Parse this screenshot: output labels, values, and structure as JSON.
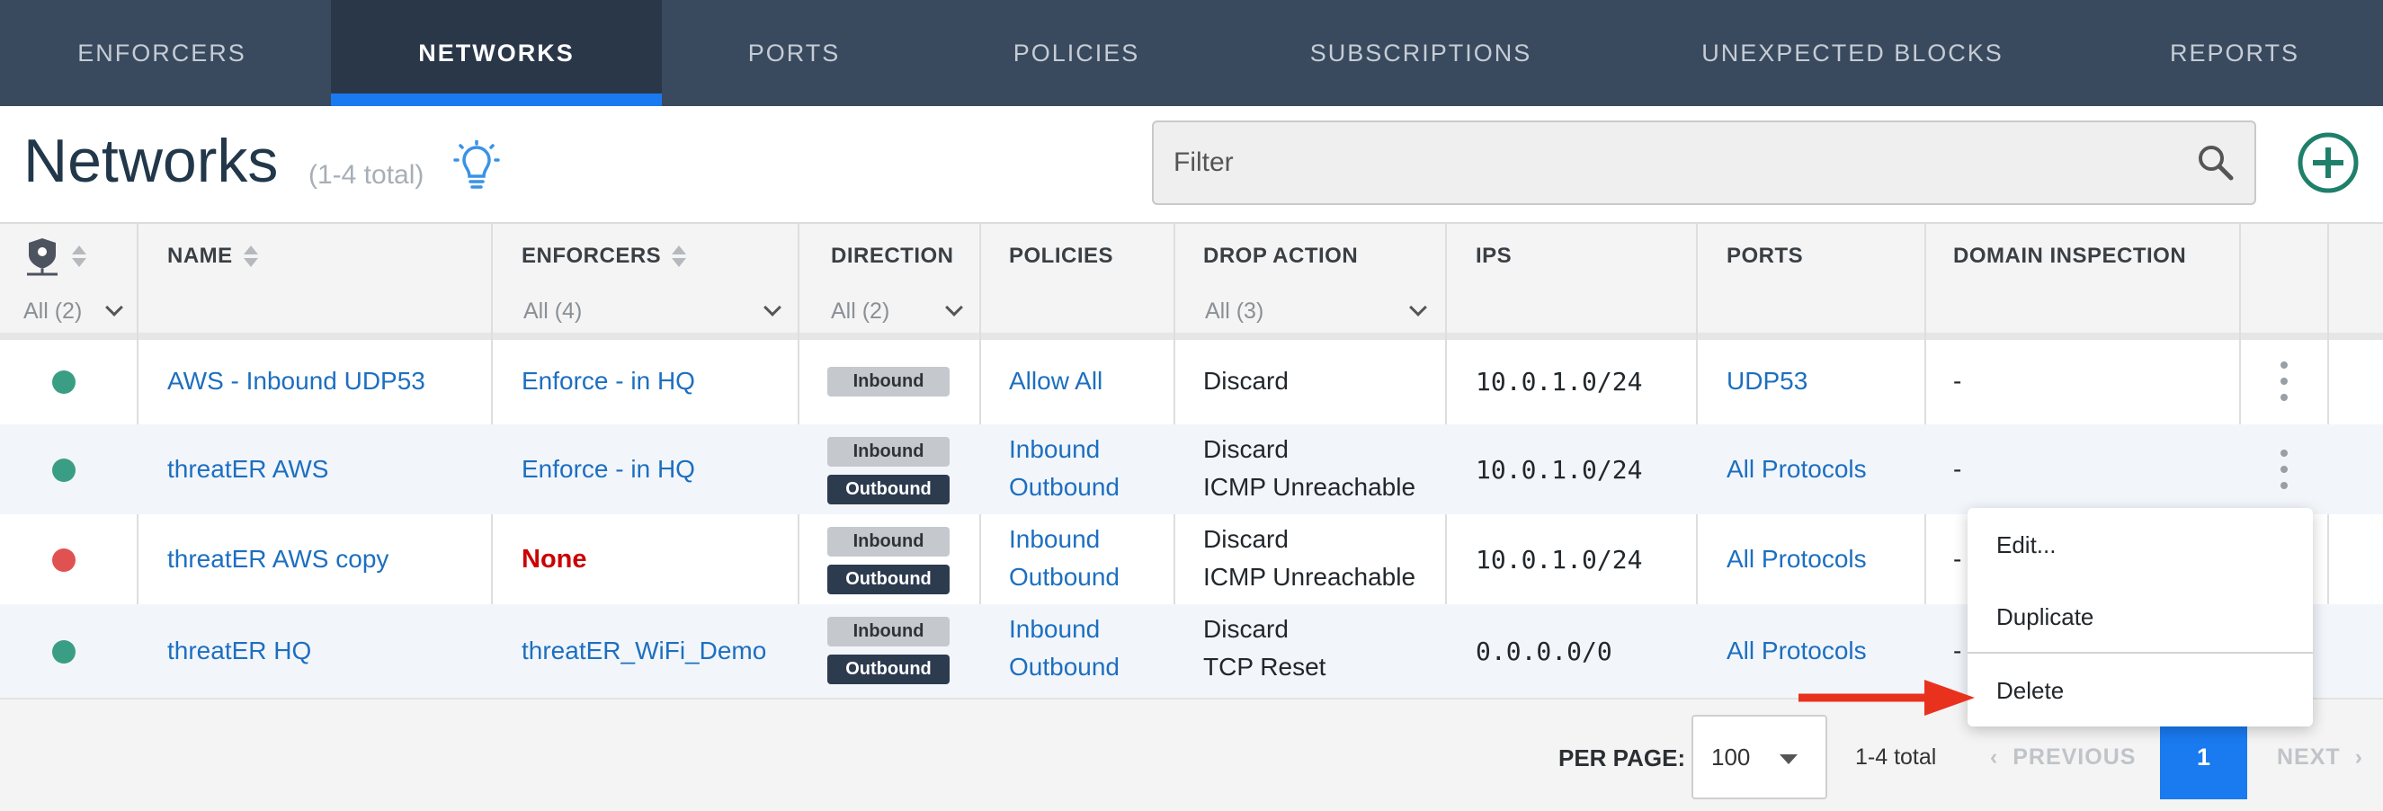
{
  "nav": {
    "tabs": [
      {
        "label": "ENFORCERS"
      },
      {
        "label": "NETWORKS",
        "active": true
      },
      {
        "label": "PORTS"
      },
      {
        "label": "POLICIES"
      },
      {
        "label": "SUBSCRIPTIONS"
      },
      {
        "label": "UNEXPECTED BLOCKS"
      },
      {
        "label": "REPORTS"
      }
    ]
  },
  "header": {
    "title": "Networks",
    "count": "(1-4 total)",
    "filter_placeholder": "Filter"
  },
  "table": {
    "columns": {
      "name": "NAME",
      "enforcers": "ENFORCERS",
      "direction": "DIRECTION",
      "policies": "POLICIES",
      "drop_action": "DROP ACTION",
      "ips": "IPS",
      "ports": "PORTS",
      "domain_inspection": "DOMAIN INSPECTION"
    },
    "filters": {
      "status": "All (2)",
      "enforcers": "All (4)",
      "direction": "All (2)",
      "drop_action": "All (3)"
    },
    "rows": [
      {
        "status_color": "#3a9e84",
        "name": "AWS - Inbound UDP53",
        "enforcer": "Enforce - in HQ",
        "direction": [
          "Inbound"
        ],
        "policies": [
          "Allow All"
        ],
        "drop_action": [
          "Discard"
        ],
        "ips": "10.0.1.0/24",
        "ports": "UDP53",
        "domain_inspection": "-"
      },
      {
        "status_color": "#3a9e84",
        "name": "threatER AWS",
        "enforcer": "Enforce - in HQ",
        "direction": [
          "Inbound",
          "Outbound"
        ],
        "policies": [
          "Inbound",
          "Outbound"
        ],
        "drop_action": [
          "Discard",
          "ICMP Unreachable"
        ],
        "ips": "10.0.1.0/24",
        "ports": "All Protocols",
        "domain_inspection": "-"
      },
      {
        "status_color": "#e05252",
        "name": "threatER AWS copy",
        "enforcer": "None",
        "direction": [
          "Inbound",
          "Outbound"
        ],
        "policies": [
          "Inbound",
          "Outbound"
        ],
        "drop_action": [
          "Discard",
          "ICMP Unreachable"
        ],
        "ips": "10.0.1.0/24",
        "ports": "All Protocols",
        "domain_inspection": "-"
      },
      {
        "status_color": "#3a9e84",
        "name": "threatER HQ",
        "enforcer": "threatER_WiFi_Demo",
        "direction": [
          "Inbound",
          "Outbound"
        ],
        "policies": [
          "Inbound",
          "Outbound"
        ],
        "drop_action": [
          "Discard",
          "TCP Reset"
        ],
        "ips": "0.0.0.0/0",
        "ports": "All Protocols",
        "domain_inspection": "-"
      }
    ]
  },
  "context_menu": {
    "items": [
      "Edit...",
      "Duplicate",
      "Delete"
    ]
  },
  "pagination": {
    "per_page_label": "PER PAGE:",
    "per_page_value": "100",
    "total": "1-4 total",
    "previous": "PREVIOUS",
    "current_page": "1",
    "next": "NEXT"
  },
  "colors": {
    "nav_bg": "#3a4a5e",
    "accent": "#1a7af0",
    "link": "#1d6fc0",
    "status_ok": "#3a9e84",
    "status_err": "#e05252",
    "annotation_arrow": "#e8321e"
  }
}
